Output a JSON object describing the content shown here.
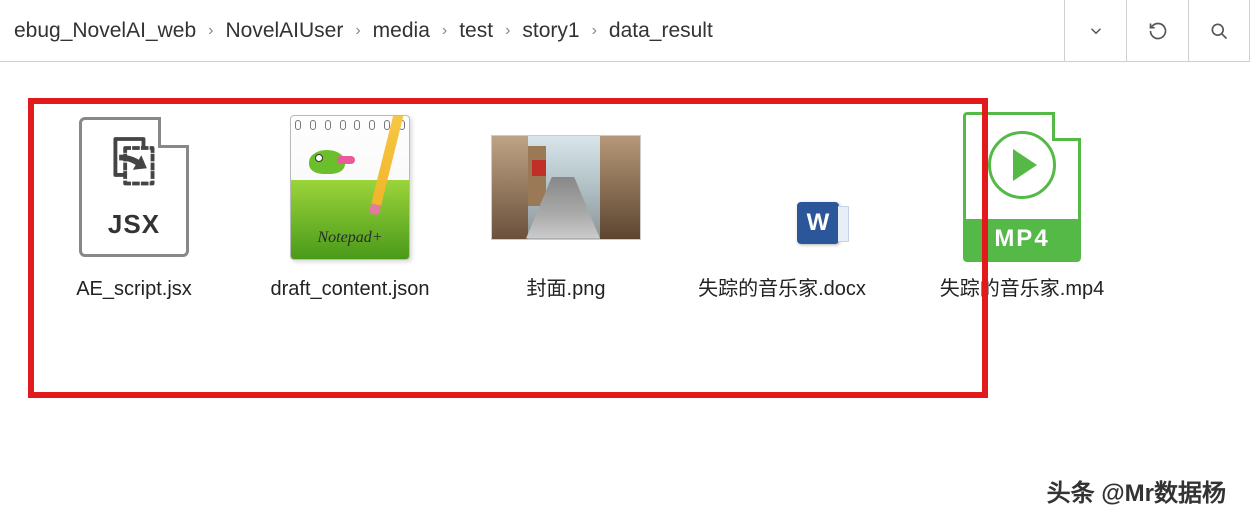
{
  "breadcrumb": {
    "items": [
      "ebug_NovelAI_web",
      "NovelAIUser",
      "media",
      "test",
      "story1",
      "data_result"
    ]
  },
  "files": {
    "f0": {
      "label": "AE_script.jsx",
      "icon_label": "JSX"
    },
    "f1": {
      "label": "draft_content.json",
      "icon_script": "Notepad+"
    },
    "f2": {
      "label": "封面.png"
    },
    "f3": {
      "label": "失踪的音乐家.docx",
      "badge": "W"
    },
    "f4": {
      "label": "失踪的音乐家.mp4",
      "band": "MP4"
    }
  },
  "watermark": "头条 @Mr数据杨"
}
